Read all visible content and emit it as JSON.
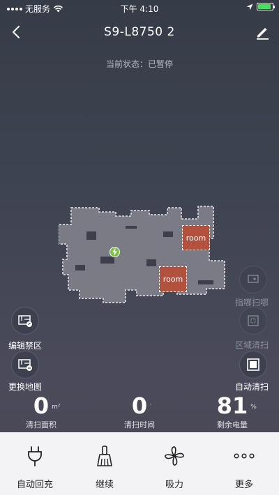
{
  "status_bar": {
    "carrier": "无服务",
    "time": "下午 4:10",
    "battery_level": 0.9
  },
  "header": {
    "title": "S9-L8750 2"
  },
  "status_text": "当前状态：已暂停",
  "map": {
    "rooms": [
      "room",
      "room"
    ]
  },
  "side_controls": {
    "left": [
      {
        "label": "编辑禁区",
        "icon": "map-edit-icon"
      },
      {
        "label": "更换地图",
        "icon": "map-switch-icon"
      }
    ],
    "right": [
      {
        "label": "指哪扫哪",
        "icon": "target-clean-icon",
        "enabled": false
      },
      {
        "label": "区域清扫",
        "icon": "zone-clean-icon",
        "enabled": false
      },
      {
        "label": "自动清扫",
        "icon": "auto-clean-icon",
        "enabled": true
      }
    ]
  },
  "stats": [
    {
      "value": "0",
      "unit": "m²",
      "label": "清扫面积"
    },
    {
      "value": "0",
      "unit": "′",
      "label": "清扫时间"
    },
    {
      "value": "81",
      "unit": "%",
      "label": "剩余电量"
    }
  ],
  "bottom_bar": [
    {
      "label": "自动回充",
      "icon": "plug-icon"
    },
    {
      "label": "继续",
      "icon": "broom-icon"
    },
    {
      "label": "吸力",
      "icon": "fan-icon"
    },
    {
      "label": "更多",
      "icon": "more-icon"
    }
  ],
  "colors": {
    "room_fill": "#b3513f",
    "charger": "#7cc142",
    "battery": "#4cd964"
  }
}
